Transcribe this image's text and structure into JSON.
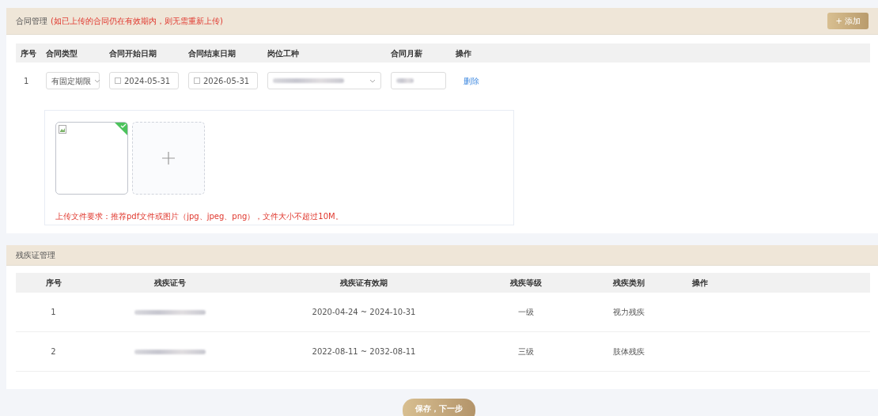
{
  "contract": {
    "title": "合同管理",
    "note": "(如已上传的合同仍在有效期内，则无需重新上传)",
    "add_button": "+ 添加",
    "columns": [
      "序号",
      "合同类型",
      "合同开始日期",
      "合同结束日期",
      "岗位工种",
      "合同月薪",
      "操作"
    ],
    "rows": [
      {
        "index": "1",
        "type": "有固定期限",
        "start": "2024-05-31",
        "end": "2026-05-31",
        "action": "删除",
        "upload": {
          "files": [
            {
              "kind": "picture",
              "uploaded": true
            }
          ],
          "hint": "上传文件要求：推荐pdf文件或图片（jpg、jpeg、png），文件大小不超过10M。"
        }
      }
    ]
  },
  "disability": {
    "title": "残疾证管理",
    "columns": [
      "序号",
      "残疾证号",
      "残疾证有效期",
      "残疾等级",
      "残疾类别",
      "操作"
    ],
    "rows": [
      {
        "index": "1",
        "validity": "2020-04-24 ~ 2024-10-31",
        "level": "一级",
        "category": "视力残疾"
      },
      {
        "index": "2",
        "validity": "2022-08-11 ~ 2032-08-11",
        "level": "三级",
        "category": "肢体残疾"
      }
    ]
  },
  "save_button": "保存，下一步"
}
